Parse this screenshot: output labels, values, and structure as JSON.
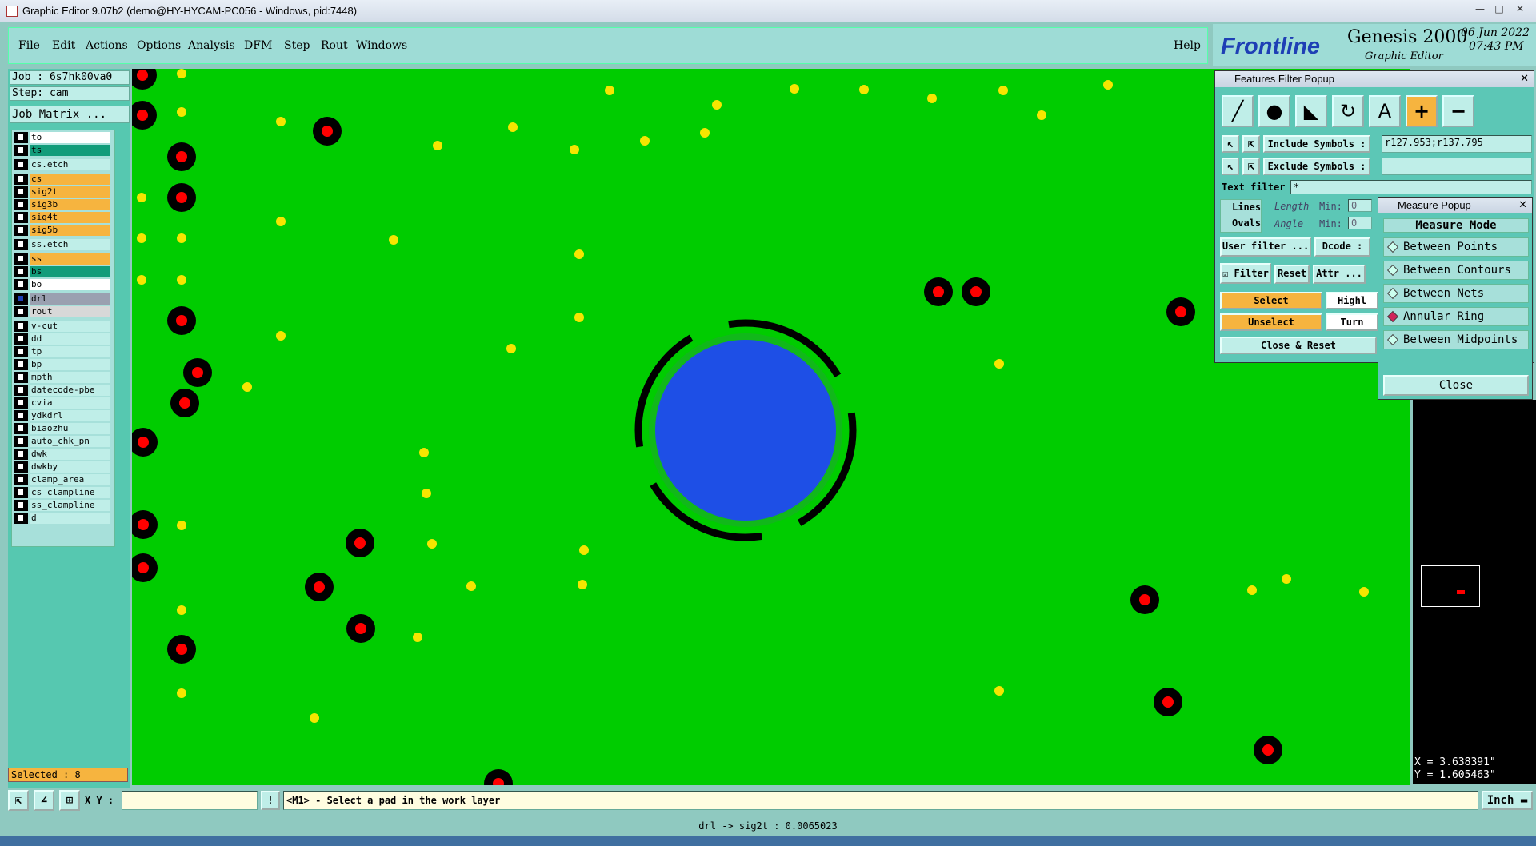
{
  "window": {
    "title": "Graphic Editor 9.07b2 (demo@HY-HYCAM-PC056 - Windows, pid:7448)"
  },
  "menu": {
    "items": [
      "File",
      "Edit",
      "Actions",
      "Options",
      "Analysis",
      "DFM",
      "Step",
      "Rout",
      "Windows"
    ],
    "help": "Help"
  },
  "logo": {
    "brand": "Frontline",
    "product": "Genesis 2000",
    "subtitle": "Graphic Editor",
    "date": "06 Jun 2022",
    "time": "07:43 PM"
  },
  "job": {
    "label": "Job : 6s7hk00va0",
    "step": "Step: cam",
    "matrix_button": "Job Matrix ..."
  },
  "layers": [
    {
      "name": "to",
      "color": "#ffffff"
    },
    {
      "name": "ts",
      "color": "#119c7a"
    },
    {
      "name": "cs.etch",
      "color": "#bfeee8"
    },
    {
      "name": "cs",
      "color": "#f6b43f"
    },
    {
      "name": "sig2t",
      "color": "#f6b43f"
    },
    {
      "name": "sig3b",
      "color": "#f6b43f"
    },
    {
      "name": "sig4t",
      "color": "#f6b43f"
    },
    {
      "name": "sig5b",
      "color": "#f6b43f"
    },
    {
      "name": "ss.etch",
      "color": "#bfeee8"
    },
    {
      "name": "ss",
      "color": "#f6b43f"
    },
    {
      "name": "bs",
      "color": "#119c7a"
    },
    {
      "name": "bo",
      "color": "#ffffff"
    },
    {
      "name": "drl",
      "color": "#9aa0b0"
    },
    {
      "name": "rout",
      "color": "#d8d8d8"
    },
    {
      "name": "v-cut",
      "color": "#bfeee8"
    },
    {
      "name": "dd",
      "color": "#bfeee8"
    },
    {
      "name": "tp",
      "color": "#bfeee8"
    },
    {
      "name": "bp",
      "color": "#bfeee8"
    },
    {
      "name": "mpth",
      "color": "#bfeee8"
    },
    {
      "name": "datecode-pbe",
      "color": "#bfeee8"
    },
    {
      "name": "cvia",
      "color": "#bfeee8"
    },
    {
      "name": "ydkdrl",
      "color": "#bfeee8"
    },
    {
      "name": "biaozhu",
      "color": "#bfeee8"
    },
    {
      "name": "auto_chk_pn",
      "color": "#bfeee8"
    },
    {
      "name": "dwk",
      "color": "#bfeee8"
    },
    {
      "name": "dwkby",
      "color": "#bfeee8"
    },
    {
      "name": "clamp_area",
      "color": "#bfeee8"
    },
    {
      "name": "cs_clampline",
      "color": "#bfeee8"
    },
    {
      "name": "ss_clampline",
      "color": "#bfeee8"
    },
    {
      "name": "d",
      "color": "#bfeee8"
    }
  ],
  "selected": "Selected : 8",
  "features_filter": {
    "title": "Features Filter Popup",
    "include_label": "Include Symbols :",
    "include_value": "r127.953;r137.795",
    "exclude_label": "Exclude Symbols :",
    "exclude_value": "",
    "text_filter_label": "Text filter",
    "text_filter_value": "*",
    "lines": "Lines",
    "ovals": "Ovals",
    "length": "Length",
    "angle": "Angle",
    "min1": "Min:",
    "min2": "Min:",
    "min1_val": "0",
    "min2_val": "0",
    "user_filter": "User filter ...",
    "dcode": "Dcode :",
    "filter": "Filter",
    "reset": "Reset",
    "attr": "Attr ...",
    "select": "Select",
    "unselect": "Unselect",
    "highlight": "Highl",
    "turn": "Turn",
    "close_reset": "Close & Reset"
  },
  "measure": {
    "title": "Measure Popup",
    "header": "Measure Mode",
    "modes": [
      "Between Points",
      "Between Contours",
      "Between Nets",
      "Annular Ring",
      "Between Midpoints"
    ],
    "active": "Annular Ring",
    "close": "Close"
  },
  "coords": {
    "x": "X = 3.638391\"",
    "y": "Y = 1.605463\""
  },
  "bottom": {
    "xy_label": "X Y :",
    "xy_value": "",
    "prompt": "<M1> - Select a pad in the work layer",
    "units": "Inch"
  },
  "status": "drl -> sig2t : 0.0065023",
  "colors": {
    "board": "#00cc00",
    "pad_black": "#000000",
    "drill_red": "#ff0000",
    "via_yellow": "#f5e600",
    "target": "#1e4fe6"
  }
}
